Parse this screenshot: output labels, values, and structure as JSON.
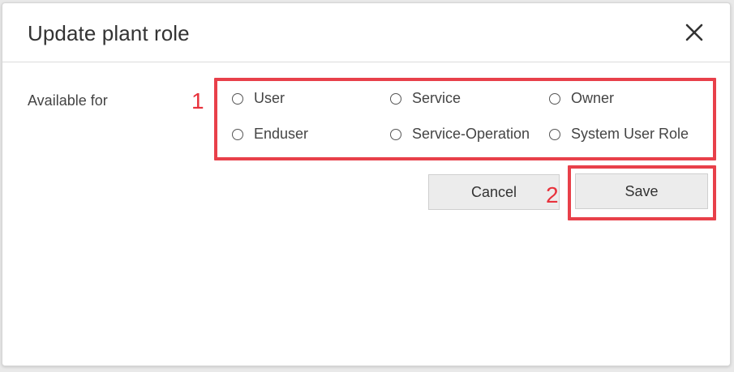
{
  "dialog": {
    "title": "Update plant role",
    "close_icon": "close-icon"
  },
  "form": {
    "available_for_label": "Available for",
    "options": [
      {
        "label": "User"
      },
      {
        "label": "Service"
      },
      {
        "label": "Owner"
      },
      {
        "label": "Enduser"
      },
      {
        "label": "Service-Operation"
      },
      {
        "label": "System User Role"
      }
    ]
  },
  "buttons": {
    "cancel_label": "Cancel",
    "save_label": "Save"
  },
  "annotations": {
    "step1": "1",
    "step2": "2",
    "highlight_color": "#e8404a"
  }
}
